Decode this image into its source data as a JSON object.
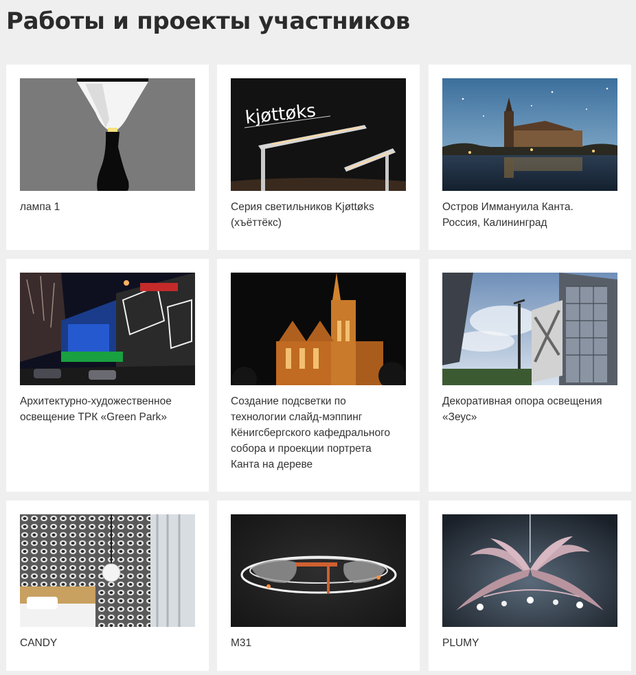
{
  "page": {
    "title": "Работы и проекты участников"
  },
  "projects": [
    {
      "caption": "лампа 1",
      "image": "lamp-render"
    },
    {
      "caption": "Серия светильников Kjøttøks\n(хъёттёкс)",
      "image": "kjottoks-streetlights",
      "logo_text": "kjøttøks"
    },
    {
      "caption": "Остров Иммануила Канта.\nРоссия, Калининград",
      "image": "kant-island-night"
    },
    {
      "caption": "Архитектурно-художественное\nосвещение ТРК «Green Park»",
      "image": "green-park-facade"
    },
    {
      "caption": "Создание подсветки по\nтехнологии слайд-мэппинг\nКёнигсбергского кафедрального\nсобора и проекции портрета\nКанта на дереве",
      "image": "cathedral-lighting"
    },
    {
      "caption": "Декоративная опора освещения\n«Зеус»",
      "image": "zeus-pole"
    },
    {
      "caption": "CANDY",
      "image": "candy-interior"
    },
    {
      "caption": "M31",
      "image": "m31-fixture"
    },
    {
      "caption": "PLUMY",
      "image": "plumy-chandelier"
    }
  ],
  "colors": {
    "background": "#efefef",
    "card": "#ffffff",
    "text": "#333333",
    "title": "#2b2b2b"
  }
}
